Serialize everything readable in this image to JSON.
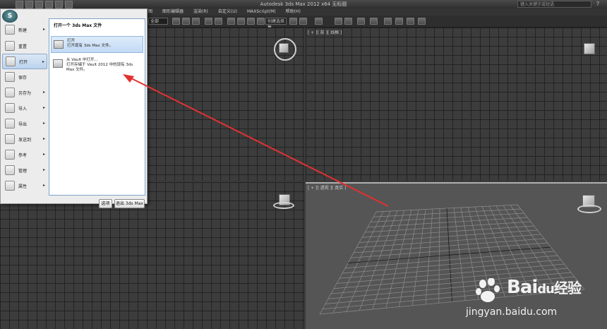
{
  "window": {
    "title": "Autodesk 3ds Max  2012 x64      无标题",
    "search_placeholder": "键入关键字或短语",
    "help_icon": "help-icon"
  },
  "menubar": {
    "items": [
      "图",
      "图形编辑器",
      "渲染(R)",
      "自定义(U)",
      "MAXScript(M)",
      "帮助(H)"
    ]
  },
  "toolbar": {
    "dropdown_left": "全部",
    "dropdown_selection": "创建选择集"
  },
  "viewports": {
    "top_right_label": "[ + ][ 前 ][ 线框 ]",
    "bottom_right_label": "[ + ][ 透视 ][ 真实 ]"
  },
  "app_menu": {
    "left_items": [
      {
        "label": "新建",
        "icon": "new-icon",
        "has_submenu": true
      },
      {
        "label": "重置",
        "icon": "reset-icon",
        "has_submenu": false
      },
      {
        "label": "打开",
        "icon": "open-folder-icon",
        "has_submenu": true,
        "selected": true
      },
      {
        "label": "保存",
        "icon": "save-icon",
        "has_submenu": false
      },
      {
        "label": "另存为",
        "icon": "save-as-icon",
        "has_submenu": true
      },
      {
        "label": "导入",
        "icon": "import-icon",
        "has_submenu": true
      },
      {
        "label": "导出",
        "icon": "export-icon",
        "has_submenu": true
      },
      {
        "label": "发送到",
        "icon": "send-to-icon",
        "has_submenu": true
      },
      {
        "label": "参考",
        "icon": "reference-icon",
        "has_submenu": true
      },
      {
        "label": "管理",
        "icon": "manage-icon",
        "has_submenu": true
      },
      {
        "label": "属性",
        "icon": "properties-icon",
        "has_submenu": true
      }
    ],
    "panel_title": "打开一个 3ds Max 文件",
    "options": [
      {
        "title": "打开",
        "desc": "打开现有 3ds Max 文件。",
        "icon": "open-folder-icon"
      },
      {
        "title": "从 Vault 中打开...",
        "desc": "打开存储于 Vault 2012 中的现有 3ds Max 文件。",
        "icon": "vault-icon"
      }
    ],
    "options_button": "选项",
    "exit_button": "退出 3ds Max"
  },
  "watermark": {
    "brand": "Bai",
    "brand_mid": "du",
    "brand_suffix": "经验",
    "url": "jingyan.baidu.com"
  },
  "colors": {
    "annotation_arrow": "#e33131",
    "selection": "#c3daf5",
    "viewport_bg": "#3c3c3c",
    "perspective_bg": "#555555"
  }
}
